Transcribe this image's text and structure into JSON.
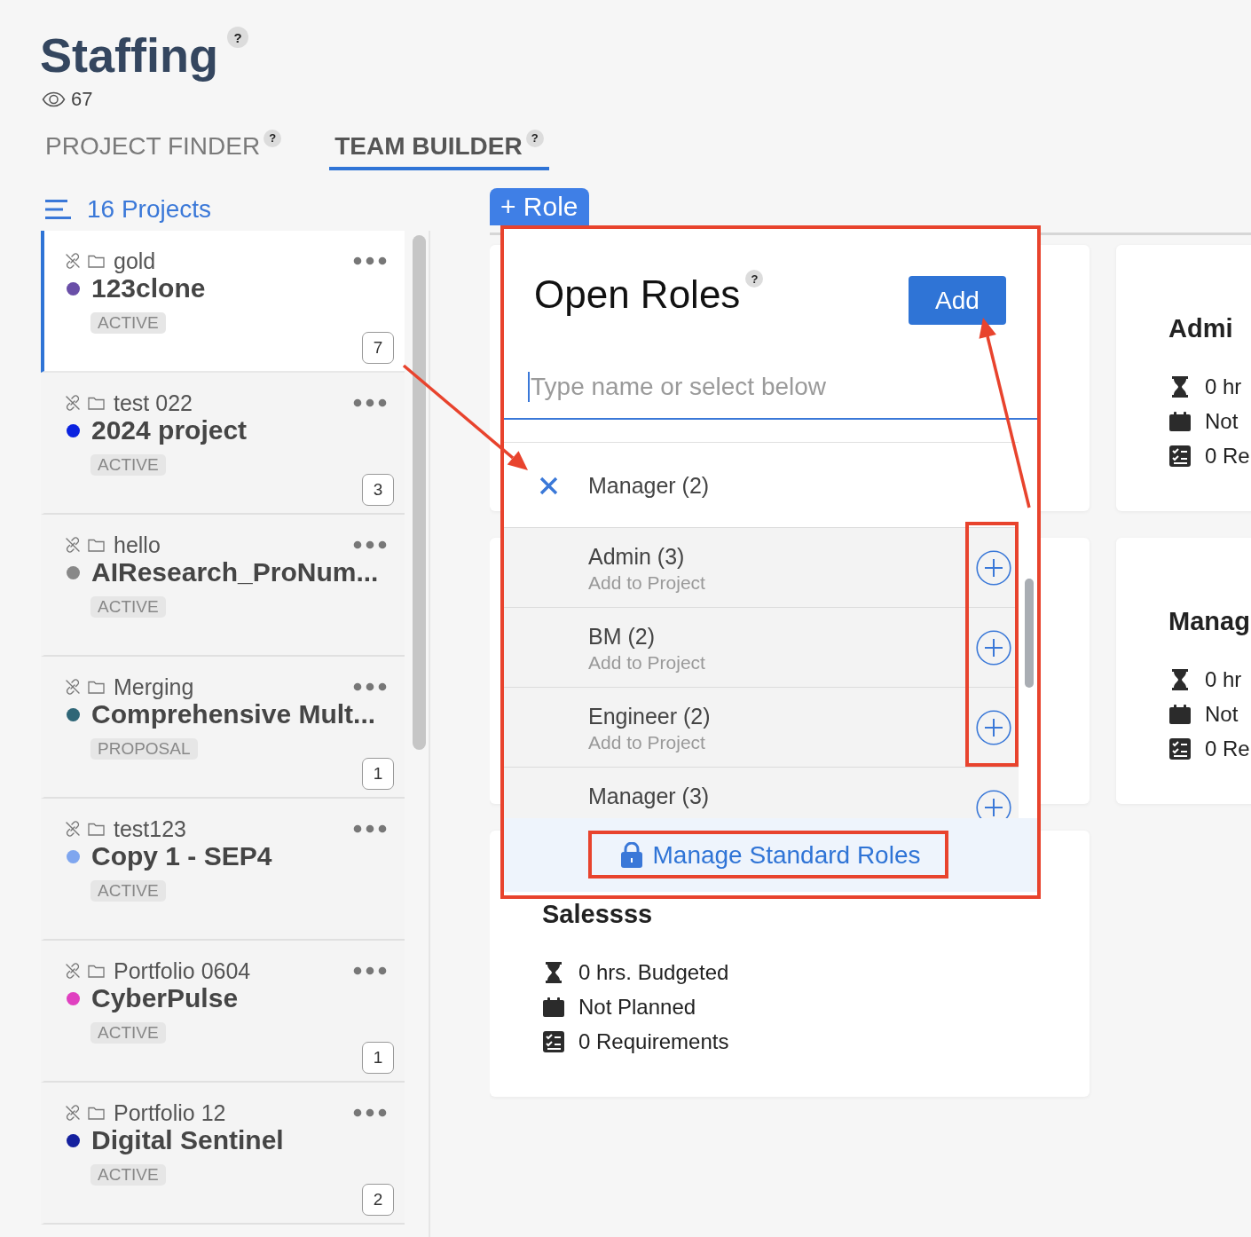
{
  "page": {
    "title": "Staffing",
    "help": "?",
    "views": "67"
  },
  "tabs": [
    {
      "label": "PROJECT FINDER",
      "help": "?",
      "selected": false
    },
    {
      "label": "TEAM BUILDER",
      "help": "?",
      "selected": true
    }
  ],
  "sidebar": {
    "count_label": "16 Projects",
    "projects": [
      {
        "portfolio": "gold",
        "name": "123clone",
        "color": "#6a4fa8",
        "status": "ACTIVE",
        "count": "7",
        "selected": true
      },
      {
        "portfolio": "test 022",
        "name": "2024 project",
        "color": "#0a22e0",
        "status": "ACTIVE",
        "count": "3",
        "selected": false
      },
      {
        "portfolio": "hello",
        "name": "AIResearch_ProNum...",
        "color": "#888888",
        "status": "ACTIVE",
        "selected": false
      },
      {
        "portfolio": "Merging",
        "name": "Comprehensive Mult...",
        "color": "#2e6677",
        "status": "PROPOSAL",
        "count": "1",
        "selected": false
      },
      {
        "portfolio": "test123",
        "name": "Copy 1 - SEP4",
        "color": "#7fa6ef",
        "status": "ACTIVE",
        "selected": false
      },
      {
        "portfolio": "Portfolio 0604",
        "name": "CyberPulse",
        "color": "#e040c0",
        "status": "ACTIVE",
        "count": "1",
        "selected": false
      },
      {
        "portfolio": "Portfolio 12",
        "name": "Digital Sentinel",
        "color": "#14209e",
        "status": "ACTIVE",
        "count": "2",
        "selected": false
      }
    ]
  },
  "toolbar": {
    "add_role": "+ Role"
  },
  "role_cards": [
    {
      "kind": "covered"
    },
    {
      "kind": "role",
      "title": "Admi",
      "lines": [
        {
          "kind": "hours",
          "text": "0 hr"
        },
        {
          "kind": "plan",
          "text": "Not"
        },
        {
          "kind": "requirements",
          "text": "0 Re"
        }
      ]
    },
    {
      "kind": "covered"
    },
    {
      "kind": "role",
      "title": "Manag",
      "lines": [
        {
          "kind": "hours",
          "text": "0 hr"
        },
        {
          "kind": "plan",
          "text": "Not"
        },
        {
          "kind": "requirements",
          "text": "0 Re"
        }
      ]
    },
    {
      "kind": "role",
      "title": "Salessss",
      "lines": [
        {
          "kind": "hours",
          "text": "0 hrs. Budgeted"
        },
        {
          "kind": "plan",
          "text": "Not Planned"
        },
        {
          "kind": "requirements",
          "text": "0 Requirements"
        }
      ]
    }
  ],
  "popup": {
    "title": "Open Roles",
    "help": "?",
    "add_button": "Add",
    "search_placeholder": "Type name or select below",
    "roles": [
      {
        "label": "Manager (2)",
        "selected": true
      },
      {
        "label": "Admin (3)",
        "hint": "Add to Project",
        "selected": false
      },
      {
        "label": "BM (2)",
        "hint": "Add to Project",
        "selected": false
      },
      {
        "label": "Engineer (2)",
        "hint": "Add to Project",
        "selected": false
      },
      {
        "label": "Manager (3)",
        "selected": false
      }
    ],
    "footer_link": "Manage Standard Roles"
  }
}
